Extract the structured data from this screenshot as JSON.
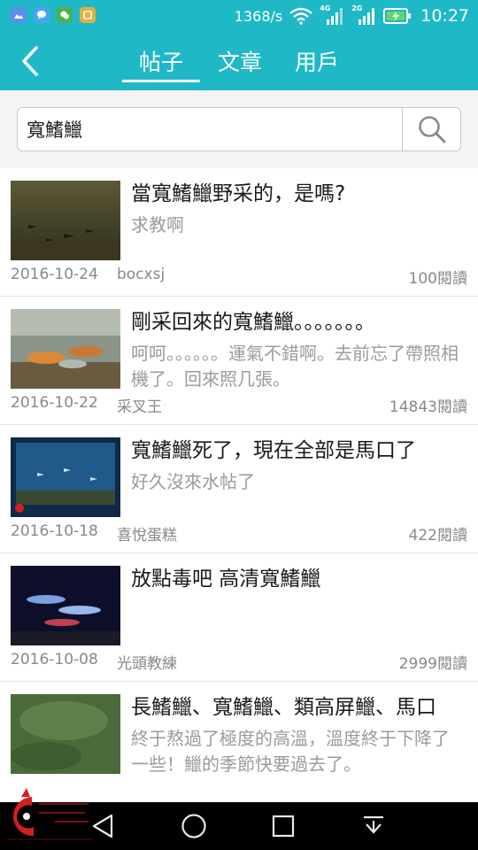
{
  "status_bar": {
    "apps": [
      {
        "icon": "photo-app-icon",
        "color": "#5b8fe8"
      },
      {
        "icon": "message-app-icon",
        "color": "#4aa3f0"
      },
      {
        "icon": "wechat-app-icon",
        "color": "#4cb050"
      },
      {
        "icon": "gallery-app-icon",
        "color": "#e0b040"
      }
    ],
    "net_speed": "1368/s",
    "signal_1_label": "4G",
    "signal_2_label": "2G",
    "time": "10:27"
  },
  "header": {
    "back_icon": "chevron-left-icon",
    "tabs": [
      "帖子",
      "文章",
      "用戶"
    ],
    "active_tab": 0
  },
  "search": {
    "value": "寬鰭鱲",
    "icon": "search-icon"
  },
  "posts": [
    {
      "title": "當寬鰭鱲野采的，是嗎?",
      "excerpt": "求教啊",
      "date": "2016-10-24",
      "author": "bocxsj",
      "views": "100閱讀"
    },
    {
      "title": "剛采回來的寬鰭鱲。。。。。。。",
      "excerpt": "呵呵。。。。。。運氣不錯啊。去前忘了帶照相機了。回來照几張。",
      "date": "2016-10-22",
      "author": "采叉王",
      "views": "14843閱讀"
    },
    {
      "title": "寬鰭鱲死了，現在全部是馬口了",
      "excerpt": "好久沒來水帖了",
      "date": "2016-10-18",
      "author": "喜悅蛋糕",
      "views": "422閱讀"
    },
    {
      "title": "放點毒吧 高清寬鰭鱲",
      "excerpt": "",
      "date": "2016-10-08",
      "author": "光頭教練",
      "views": "2999閱讀"
    },
    {
      "title": "長鰭鱲、寬鰭鱲、類高屏鱲、馬口",
      "excerpt": "終于熬過了極度的高溫，溫度終于下降了一些！鱲的季節快要過去了。",
      "date": "",
      "author": "",
      "views": ""
    }
  ],
  "nav": {
    "back": "nav-back-icon",
    "home": "nav-home-icon",
    "recents": "nav-recents-icon",
    "notifications": "nav-pulldown-icon"
  }
}
